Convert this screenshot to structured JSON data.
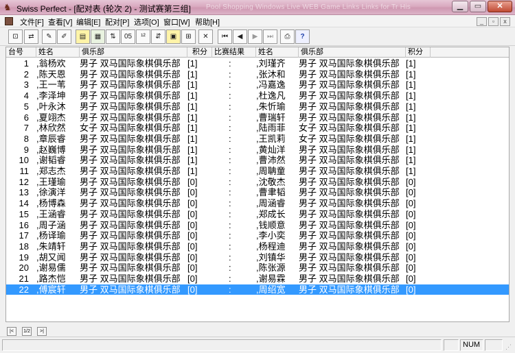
{
  "window": {
    "title": "Swiss Perfect - [配对表 (轮次 2) - 测试赛第三组]",
    "ghost_tabs": "Pool Shopping    Windows Live    WEB Game    Links    Links for Tr    His"
  },
  "menu": [
    "文件[F]",
    "查看[V]",
    "编辑[E]",
    "配对[P]",
    "选项[O]",
    "窗口[W]",
    "帮助[H]"
  ],
  "toolbar": {
    "icons": [
      "new-pairing-icon",
      "swap-icon",
      "pen-icon",
      "pen-edit-icon",
      "notebook-icon",
      "table-icon",
      "flip-icon",
      "year-2005-icon",
      "numeric-icon",
      "image-icon",
      "columns-icon",
      "cross-icon",
      "first-icon",
      "prev-icon",
      "next-icon",
      "last-icon",
      "printer-icon",
      "help-icon"
    ]
  },
  "grid": {
    "headers": [
      "台号",
      "姓名",
      "俱乐部",
      "积分",
      "比赛结果",
      "姓名",
      "俱乐部",
      "积分"
    ],
    "rows": [
      {
        "no": "1",
        "n1": ",翁杨欢",
        "k1": "男子 双马国际象棋俱乐部",
        "s1": "[1]",
        "res": ":",
        "n2": ",刘瑾齐",
        "k2": "男子 双马国际象棋俱乐部",
        "s2": "[1]"
      },
      {
        "no": "2",
        "n1": ",陈天恩",
        "k1": "男子 双马国际象棋俱乐部",
        "s1": "[1]",
        "res": ":",
        "n2": ",张沐和",
        "k2": "男子 双马国际象棋俱乐部",
        "s2": "[1]"
      },
      {
        "no": "3",
        "n1": ",王一苇",
        "k1": "男子 双马国际象棋俱乐部",
        "s1": "[1]",
        "res": ":",
        "n2": ",冯嘉逸",
        "k2": "男子 双马国际象棋俱乐部",
        "s2": "[1]"
      },
      {
        "no": "4",
        "n1": ",李泽坤",
        "k1": "男子 双马国际象棋俱乐部",
        "s1": "[1]",
        "res": ":",
        "n2": ",杜逸凡",
        "k2": "男子 双马国际象棋俱乐部",
        "s2": "[1]"
      },
      {
        "no": "5",
        "n1": ",叶永沐",
        "k1": "男子 双马国际象棋俱乐部",
        "s1": "[1]",
        "res": ":",
        "n2": ",朱忻瑜",
        "k2": "男子 双马国际象棋俱乐部",
        "s2": "[1]"
      },
      {
        "no": "6",
        "n1": ",夏翊杰",
        "k1": "男子 双马国际象棋俱乐部",
        "s1": "[1]",
        "res": ":",
        "n2": ",曹瑞轩",
        "k2": "男子 双马国际象棋俱乐部",
        "s2": "[1]"
      },
      {
        "no": "7",
        "n1": ",林欣然",
        "k1": "女子 双马国际象棋俱乐部",
        "s1": "[1]",
        "res": ":",
        "n2": ",陆雨菲",
        "k2": "女子 双马国际象棋俱乐部",
        "s2": "[1]"
      },
      {
        "no": "8",
        "n1": ",章辰睿",
        "k1": "男子 双马国际象棋俱乐部",
        "s1": "[1]",
        "res": ":",
        "n2": ",王凯莉",
        "k2": "女子 双马国际象棋俱乐部",
        "s2": "[1]"
      },
      {
        "no": "9",
        "n1": ",赵巍博",
        "k1": "男子 双马国际象棋俱乐部",
        "s1": "[1]",
        "res": ":",
        "n2": ",黄灿洋",
        "k2": "男子 双马国际象棋俱乐部",
        "s2": "[1]"
      },
      {
        "no": "10",
        "n1": ",谢韬睿",
        "k1": "男子 双马国际象棋俱乐部",
        "s1": "[1]",
        "res": ":",
        "n2": ",曹沛然",
        "k2": "男子 双马国际象棋俱乐部",
        "s2": "[1]"
      },
      {
        "no": "11",
        "n1": ",郑志杰",
        "k1": "男子 双马国际象棋俱乐部",
        "s1": "[1]",
        "res": ":",
        "n2": ",周聃童",
        "k2": "男子 双马国际象棋俱乐部",
        "s2": "[1]"
      },
      {
        "no": "12",
        "n1": ",王瑾瑜",
        "k1": "男子 双马国际象棋俱乐部",
        "s1": "[0]",
        "res": ":",
        "n2": ",沈敬杰",
        "k2": "男子 双马国际象棋俱乐部",
        "s2": "[0]"
      },
      {
        "no": "13",
        "n1": ",徐演洋",
        "k1": "男子 双马国际象棋俱乐部",
        "s1": "[0]",
        "res": ":",
        "n2": ",曹聿韬",
        "k2": "男子 双马国际象棋俱乐部",
        "s2": "[0]"
      },
      {
        "no": "14",
        "n1": ",杨博森",
        "k1": "男子 双马国际象棋俱乐部",
        "s1": "[0]",
        "res": ":",
        "n2": ",周涵睿",
        "k2": "男子 双马国际象棋俱乐部",
        "s2": "[0]"
      },
      {
        "no": "15",
        "n1": ",王涵睿",
        "k1": "男子 双马国际象棋俱乐部",
        "s1": "[0]",
        "res": ":",
        "n2": ",郑成长",
        "k2": "男子 双马国际象棋俱乐部",
        "s2": "[0]"
      },
      {
        "no": "16",
        "n1": ",周子涵",
        "k1": "男子 双马国际象棋俱乐部",
        "s1": "[0]",
        "res": ":",
        "n2": ",钱顺意",
        "k2": "男子 双马国际象棋俱乐部",
        "s2": "[0]"
      },
      {
        "no": "17",
        "n1": ",杨译瑜",
        "k1": "男子 双马国际象棋俱乐部",
        "s1": "[0]",
        "res": ":",
        "n2": ",李小奕",
        "k2": "男子 双马国际象棋俱乐部",
        "s2": "[0]"
      },
      {
        "no": "18",
        "n1": ",朱靖轩",
        "k1": "男子 双马国际象棋俱乐部",
        "s1": "[0]",
        "res": ":",
        "n2": ",杨程迪",
        "k2": "男子 双马国际象棋俱乐部",
        "s2": "[0]"
      },
      {
        "no": "19",
        "n1": ",胡又闻",
        "k1": "男子 双马国际象棋俱乐部",
        "s1": "[0]",
        "res": ":",
        "n2": ",刘镇华",
        "k2": "男子 双马国际象棋俱乐部",
        "s2": "[0]"
      },
      {
        "no": "20",
        "n1": ",谢易儒",
        "k1": "男子 双马国际象棋俱乐部",
        "s1": "[0]",
        "res": ":",
        "n2": ",陈张源",
        "k2": "男子 双马国际象棋俱乐部",
        "s2": "[0]"
      },
      {
        "no": "21",
        "n1": ",路杰恺",
        "k1": "男子 双马国际象棋俱乐部",
        "s1": "[0]",
        "res": ":",
        "n2": ",谢易霖",
        "k2": "男子 双马国际象棋俱乐部",
        "s2": "[0]"
      },
      {
        "no": "22",
        "n1": ",傅宸轩",
        "k1": "男子 双马国际象棋俱乐部",
        "s1": "[0]",
        "res": ":",
        "n2": ",周绍宽",
        "k2": "男子 双马国际象棋俱乐部",
        "s2": "[0]",
        "selected": true
      }
    ]
  },
  "bottom_nav": [
    "|<",
    "1/2",
    ">|"
  ],
  "status": {
    "num": "NUM"
  },
  "colors": {
    "selection": "#3399ff",
    "title_bar": "#d9a9bf"
  }
}
